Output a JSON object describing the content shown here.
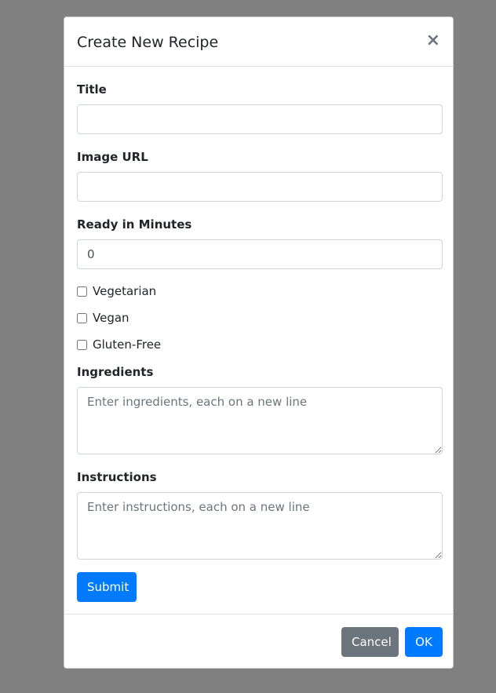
{
  "modal": {
    "title": "Create New Recipe",
    "close_symbol": "×"
  },
  "form": {
    "title_label": "Title",
    "title_value": "",
    "image_url_label": "Image URL",
    "image_url_value": "",
    "ready_label": "Ready in Minutes",
    "ready_value": "0",
    "checkboxes": [
      {
        "label": "Vegetarian",
        "checked": false
      },
      {
        "label": "Vegan",
        "checked": false
      },
      {
        "label": "Gluten-Free",
        "checked": false
      }
    ],
    "ingredients_label": "Ingredients",
    "ingredients_placeholder": "Enter ingredients, each on a new line",
    "instructions_label": "Instructions",
    "instructions_placeholder": "Enter instructions, each on a new line",
    "submit_label": "Submit"
  },
  "footer": {
    "cancel_label": "Cancel",
    "ok_label": "OK"
  },
  "colors": {
    "backdrop": "#808080",
    "primary": "#007bff",
    "secondary": "#6c757d"
  }
}
